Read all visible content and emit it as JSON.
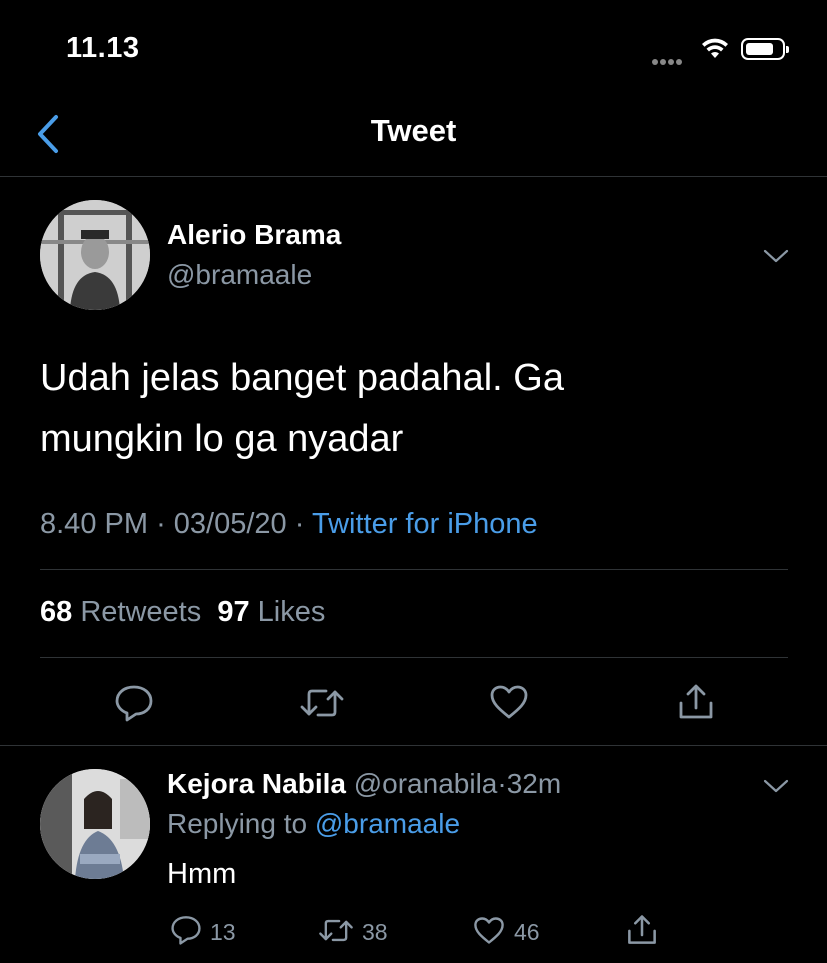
{
  "status_bar": {
    "time": "11.13"
  },
  "nav": {
    "title": "Tweet"
  },
  "tweet": {
    "author_name": "Alerio Brama",
    "author_handle": "@bramaale",
    "text_line1": "Udah jelas banget padahal. Ga",
    "text_line2": "mungkin lo ga nyadar",
    "time": "8.40 PM",
    "date": "03/05/20",
    "separator": "·",
    "source": "Twitter for iPhone",
    "retweet_count": "68",
    "retweet_label": "Retweets",
    "like_count": "97",
    "like_label": "Likes"
  },
  "reply": {
    "author_name": "Kejora Nabila",
    "author_handle": "@oranabila",
    "separator": "·",
    "age": "32m",
    "replying_prefix": "Replying to",
    "replying_mention": "@bramaale",
    "text": "Hmm",
    "reply_count": "13",
    "retweet_count": "38",
    "like_count": "46"
  },
  "colors": {
    "background": "#000000",
    "accent": "#4a9de8",
    "secondary_text": "#8b98a5",
    "divider": "#2f3336"
  },
  "icons": [
    "back-chevron-icon",
    "wifi-icon",
    "battery-icon",
    "chevron-down-icon",
    "reply-icon",
    "retweet-icon",
    "like-icon",
    "share-icon"
  ]
}
